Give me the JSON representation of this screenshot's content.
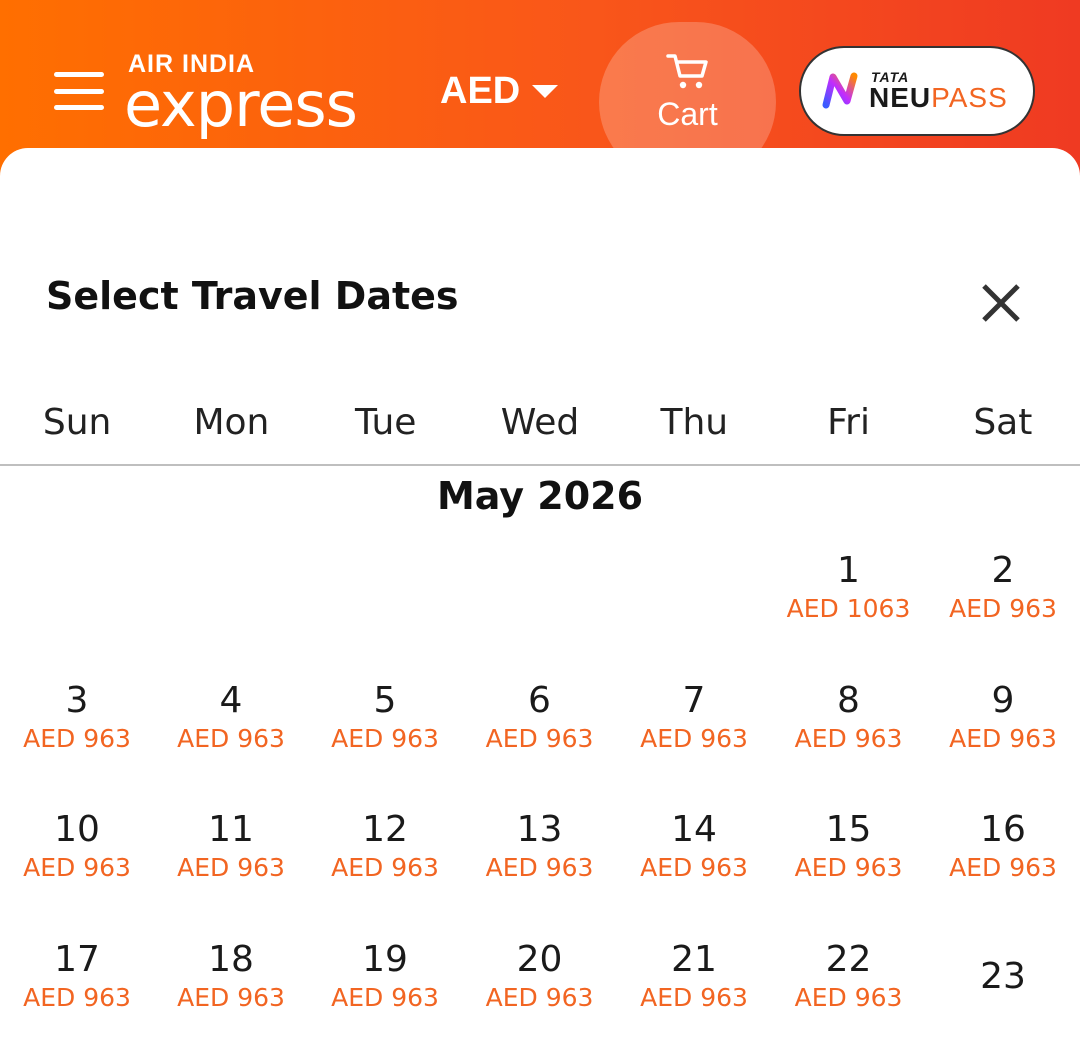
{
  "header": {
    "logo_top": "AIR INDIA",
    "logo_main": "express",
    "currency": "AED",
    "cart_label": "Cart",
    "neupass_top": "TATA",
    "neupass_bold": "NEU",
    "neupass_rest": "PASS",
    "colors": {
      "gradient_start": "#ff6f00",
      "gradient_end": "#ef3a22",
      "accent": "#f26522"
    }
  },
  "sheet": {
    "title": "Select Travel Dates",
    "weekdays": [
      "Sun",
      "Mon",
      "Tue",
      "Wed",
      "Thu",
      "Fri",
      "Sat"
    ],
    "month_label": "May 2026"
  },
  "calendar": {
    "days": [
      {
        "day": "",
        "price": ""
      },
      {
        "day": "",
        "price": ""
      },
      {
        "day": "",
        "price": ""
      },
      {
        "day": "",
        "price": ""
      },
      {
        "day": "",
        "price": ""
      },
      {
        "day": "1",
        "price": "AED 1063"
      },
      {
        "day": "2",
        "price": "AED 963"
      },
      {
        "day": "3",
        "price": "AED 963"
      },
      {
        "day": "4",
        "price": "AED 963"
      },
      {
        "day": "5",
        "price": "AED 963"
      },
      {
        "day": "6",
        "price": "AED 963"
      },
      {
        "day": "7",
        "price": "AED 963"
      },
      {
        "day": "8",
        "price": "AED 963"
      },
      {
        "day": "9",
        "price": "AED 963"
      },
      {
        "day": "10",
        "price": "AED 963"
      },
      {
        "day": "11",
        "price": "AED 963"
      },
      {
        "day": "12",
        "price": "AED 963"
      },
      {
        "day": "13",
        "price": "AED 963"
      },
      {
        "day": "14",
        "price": "AED 963"
      },
      {
        "day": "15",
        "price": "AED 963"
      },
      {
        "day": "16",
        "price": "AED 963"
      },
      {
        "day": "17",
        "price": "AED 963"
      },
      {
        "day": "18",
        "price": "AED 963"
      },
      {
        "day": "19",
        "price": "AED 963"
      },
      {
        "day": "20",
        "price": "AED 963"
      },
      {
        "day": "21",
        "price": "AED 963"
      },
      {
        "day": "22",
        "price": "AED 963"
      },
      {
        "day": "23",
        "price": ""
      }
    ]
  }
}
